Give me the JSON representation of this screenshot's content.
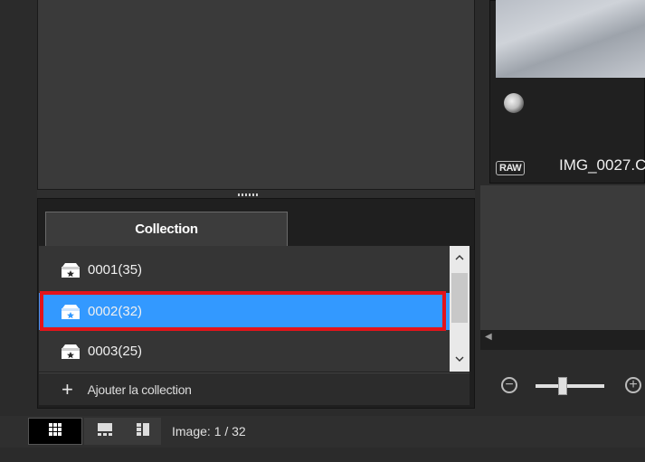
{
  "collection_panel": {
    "tab_label": "Collection",
    "items": [
      {
        "label": "0001(35)",
        "selected": false
      },
      {
        "label": "0002(32)",
        "selected": true
      },
      {
        "label": "0003(25)",
        "selected": false
      }
    ],
    "add_label": "Ajouter la collection"
  },
  "status_bar": {
    "image_counter": "Image: 1 / 32"
  },
  "thumbnail": {
    "badge": "RAW",
    "file_name": "IMG_0027.C"
  },
  "colors": {
    "selected_row": "#3399ff",
    "highlight_outline": "#e3141b",
    "panel_bg": "#353535"
  },
  "icons": {
    "collection": "collection-box-icon",
    "add": "plus-icon",
    "zoom_out": "zoom-out-icon",
    "zoom_in": "zoom-in-icon"
  }
}
